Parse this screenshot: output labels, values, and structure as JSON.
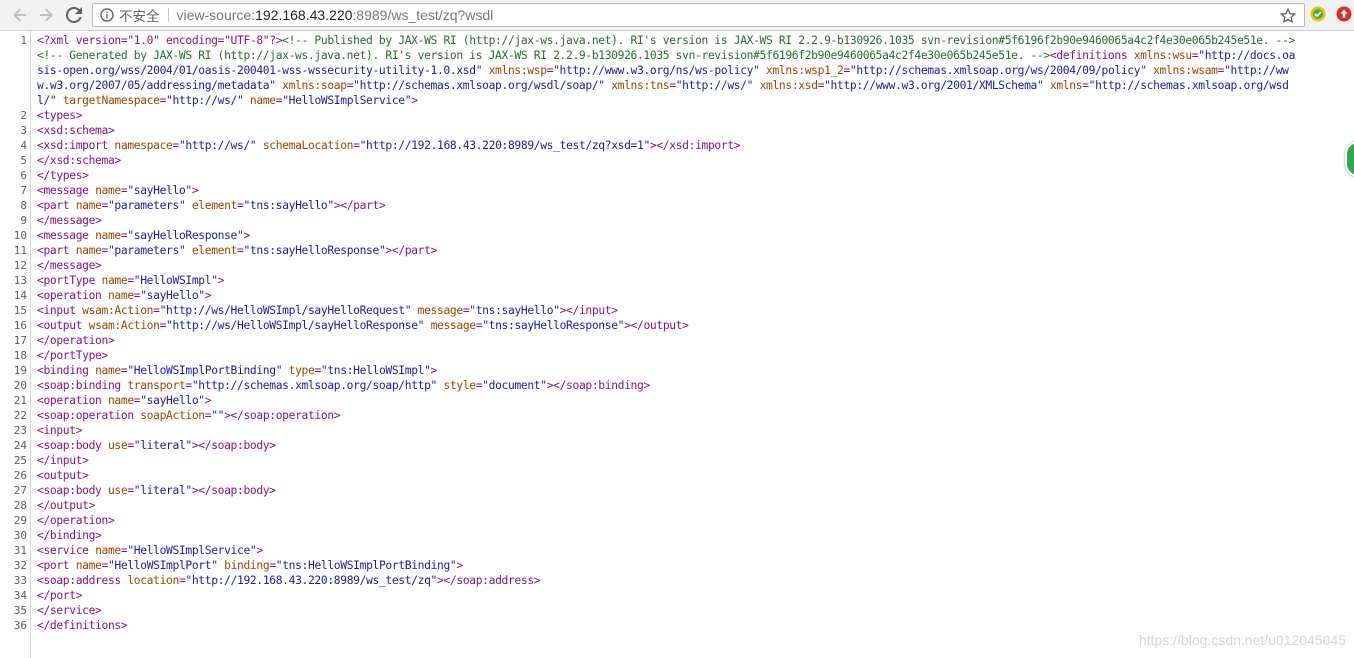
{
  "browser": {
    "security_label": "不安全",
    "url_scheme": "view-source:",
    "url_host": "192.168.43.220",
    "url_rest": ":8989/ws_test/zq?wsdl"
  },
  "source_lines": [
    {
      "n": "1",
      "parts": [
        [
          "pi",
          "<?xml version=\"1.0\" encoding=\"UTF-8\"?>"
        ],
        [
          "cm",
          "<!-- Published by JAX-WS RI (http://jax-ws.java.net). RI's version is JAX-WS RI 2.2.9-b130926.1035 svn-revision#5f6196f2b90e9460065a4c2f4e30e065b245e51e. -->"
        ],
        [
          "cm",
          "<!-- Generated by JAX-WS RI (http://jax-ws.java.net). RI's version is JAX-WS RI 2.2.9-b130926.1035 svn-revision#5f6196f2b90e9460065a4c2f4e30e065b245e51e. -->"
        ],
        [
          "t",
          "<definitions "
        ],
        [
          "an",
          "xmlns:wsu"
        ],
        [
          "t",
          "="
        ],
        [
          "av",
          "\"http://docs.oasis-open.org/wss/2004/01/oasis-200401-wss-wssecurity-utility-1.0.xsd\""
        ],
        [
          "t",
          " "
        ],
        [
          "an",
          "xmlns:wsp"
        ],
        [
          "t",
          "="
        ],
        [
          "av",
          "\"http://www.w3.org/ns/ws-policy\""
        ],
        [
          "t",
          " "
        ],
        [
          "an",
          "xmlns:wsp1_2"
        ],
        [
          "t",
          "="
        ],
        [
          "av",
          "\"http://schemas.xmlsoap.org/ws/2004/09/policy\""
        ],
        [
          "t",
          " "
        ],
        [
          "an",
          "xmlns:wsam"
        ],
        [
          "t",
          "="
        ],
        [
          "av",
          "\"http://www.w3.org/2007/05/addressing/metadata\""
        ],
        [
          "t",
          " "
        ],
        [
          "an",
          "xmlns:soap"
        ],
        [
          "t",
          "="
        ],
        [
          "av",
          "\"http://schemas.xmlsoap.org/wsdl/soap/\""
        ],
        [
          "t",
          " "
        ],
        [
          "an",
          "xmlns:tns"
        ],
        [
          "t",
          "="
        ],
        [
          "av",
          "\"http://ws/\""
        ],
        [
          "t",
          " "
        ],
        [
          "an",
          "xmlns:xsd"
        ],
        [
          "t",
          "="
        ],
        [
          "av",
          "\"http://www.w3.org/2001/XMLSchema\""
        ],
        [
          "t",
          " "
        ],
        [
          "an",
          "xmlns"
        ],
        [
          "t",
          "="
        ],
        [
          "av",
          "\"http://schemas.xmlsoap.org/wsdl/\""
        ],
        [
          "t",
          " "
        ],
        [
          "an",
          "targetNamespace"
        ],
        [
          "t",
          "="
        ],
        [
          "av",
          "\"http://ws/\""
        ],
        [
          "t",
          " "
        ],
        [
          "an",
          "name"
        ],
        [
          "t",
          "="
        ],
        [
          "av",
          "\"HelloWSImplService\""
        ],
        [
          "t",
          ">"
        ]
      ]
    },
    {
      "n": "2",
      "parts": [
        [
          "t",
          "<types>"
        ]
      ]
    },
    {
      "n": "3",
      "parts": [
        [
          "t",
          "<xsd:schema>"
        ]
      ]
    },
    {
      "n": "4",
      "parts": [
        [
          "t",
          "<xsd:import "
        ],
        [
          "an",
          "namespace"
        ],
        [
          "t",
          "="
        ],
        [
          "av",
          "\"http://ws/\""
        ],
        [
          "t",
          " "
        ],
        [
          "an",
          "schemaLocation"
        ],
        [
          "t",
          "="
        ],
        [
          "av",
          "\"http://192.168.43.220:8989/ws_test/zq?xsd=1\""
        ],
        [
          "t",
          "></xsd:import>"
        ]
      ]
    },
    {
      "n": "5",
      "parts": [
        [
          "t",
          "</xsd:schema>"
        ]
      ]
    },
    {
      "n": "6",
      "parts": [
        [
          "t",
          "</types>"
        ]
      ]
    },
    {
      "n": "7",
      "parts": [
        [
          "t",
          "<message "
        ],
        [
          "an",
          "name"
        ],
        [
          "t",
          "="
        ],
        [
          "av",
          "\"sayHello\""
        ],
        [
          "t",
          ">"
        ]
      ]
    },
    {
      "n": "8",
      "parts": [
        [
          "t",
          "<part "
        ],
        [
          "an",
          "name"
        ],
        [
          "t",
          "="
        ],
        [
          "av",
          "\"parameters\""
        ],
        [
          "t",
          " "
        ],
        [
          "an",
          "element"
        ],
        [
          "t",
          "="
        ],
        [
          "av",
          "\"tns:sayHello\""
        ],
        [
          "t",
          "></part>"
        ]
      ]
    },
    {
      "n": "9",
      "parts": [
        [
          "t",
          "</message>"
        ]
      ]
    },
    {
      "n": "10",
      "parts": [
        [
          "t",
          "<message "
        ],
        [
          "an",
          "name"
        ],
        [
          "t",
          "="
        ],
        [
          "av",
          "\"sayHelloResponse\""
        ],
        [
          "t",
          ">"
        ]
      ]
    },
    {
      "n": "11",
      "parts": [
        [
          "t",
          "<part "
        ],
        [
          "an",
          "name"
        ],
        [
          "t",
          "="
        ],
        [
          "av",
          "\"parameters\""
        ],
        [
          "t",
          " "
        ],
        [
          "an",
          "element"
        ],
        [
          "t",
          "="
        ],
        [
          "av",
          "\"tns:sayHelloResponse\""
        ],
        [
          "t",
          "></part>"
        ]
      ]
    },
    {
      "n": "12",
      "parts": [
        [
          "t",
          "</message>"
        ]
      ]
    },
    {
      "n": "13",
      "parts": [
        [
          "t",
          "<portType "
        ],
        [
          "an",
          "name"
        ],
        [
          "t",
          "="
        ],
        [
          "av",
          "\"HelloWSImpl\""
        ],
        [
          "t",
          ">"
        ]
      ]
    },
    {
      "n": "14",
      "parts": [
        [
          "t",
          "<operation "
        ],
        [
          "an",
          "name"
        ],
        [
          "t",
          "="
        ],
        [
          "av",
          "\"sayHello\""
        ],
        [
          "t",
          ">"
        ]
      ]
    },
    {
      "n": "15",
      "parts": [
        [
          "t",
          "<input "
        ],
        [
          "an",
          "wsam:Action"
        ],
        [
          "t",
          "="
        ],
        [
          "av",
          "\"http://ws/HelloWSImpl/sayHelloRequest\""
        ],
        [
          "t",
          " "
        ],
        [
          "an",
          "message"
        ],
        [
          "t",
          "="
        ],
        [
          "av",
          "\"tns:sayHello\""
        ],
        [
          "t",
          "></input>"
        ]
      ]
    },
    {
      "n": "16",
      "parts": [
        [
          "t",
          "<output "
        ],
        [
          "an",
          "wsam:Action"
        ],
        [
          "t",
          "="
        ],
        [
          "av",
          "\"http://ws/HelloWSImpl/sayHelloResponse\""
        ],
        [
          "t",
          " "
        ],
        [
          "an",
          "message"
        ],
        [
          "t",
          "="
        ],
        [
          "av",
          "\"tns:sayHelloResponse\""
        ],
        [
          "t",
          "></output>"
        ]
      ]
    },
    {
      "n": "17",
      "parts": [
        [
          "t",
          "</operation>"
        ]
      ]
    },
    {
      "n": "18",
      "parts": [
        [
          "t",
          "</portType>"
        ]
      ]
    },
    {
      "n": "19",
      "parts": [
        [
          "t",
          "<binding "
        ],
        [
          "an",
          "name"
        ],
        [
          "t",
          "="
        ],
        [
          "av",
          "\"HelloWSImplPortBinding\""
        ],
        [
          "t",
          " "
        ],
        [
          "an",
          "type"
        ],
        [
          "t",
          "="
        ],
        [
          "av",
          "\"tns:HelloWSImpl\""
        ],
        [
          "t",
          ">"
        ]
      ]
    },
    {
      "n": "20",
      "parts": [
        [
          "t",
          "<soap:binding "
        ],
        [
          "an",
          "transport"
        ],
        [
          "t",
          "="
        ],
        [
          "av",
          "\"http://schemas.xmlsoap.org/soap/http\""
        ],
        [
          "t",
          " "
        ],
        [
          "an",
          "style"
        ],
        [
          "t",
          "="
        ],
        [
          "av",
          "\"document\""
        ],
        [
          "t",
          "></soap:binding>"
        ]
      ]
    },
    {
      "n": "21",
      "parts": [
        [
          "t",
          "<operation "
        ],
        [
          "an",
          "name"
        ],
        [
          "t",
          "="
        ],
        [
          "av",
          "\"sayHello\""
        ],
        [
          "t",
          ">"
        ]
      ]
    },
    {
      "n": "22",
      "parts": [
        [
          "t",
          "<soap:operation "
        ],
        [
          "an",
          "soapAction"
        ],
        [
          "t",
          "="
        ],
        [
          "av",
          "\"\""
        ],
        [
          "t",
          "></soap:operation>"
        ]
      ]
    },
    {
      "n": "23",
      "parts": [
        [
          "t",
          "<input>"
        ]
      ]
    },
    {
      "n": "24",
      "parts": [
        [
          "t",
          "<soap:body "
        ],
        [
          "an",
          "use"
        ],
        [
          "t",
          "="
        ],
        [
          "av",
          "\"literal\""
        ],
        [
          "t",
          "></soap:body>"
        ]
      ]
    },
    {
      "n": "25",
      "parts": [
        [
          "t",
          "</input>"
        ]
      ]
    },
    {
      "n": "26",
      "parts": [
        [
          "t",
          "<output>"
        ]
      ]
    },
    {
      "n": "27",
      "parts": [
        [
          "t",
          "<soap:body "
        ],
        [
          "an",
          "use"
        ],
        [
          "t",
          "="
        ],
        [
          "av",
          "\"literal\""
        ],
        [
          "t",
          "></soap:body>"
        ]
      ]
    },
    {
      "n": "28",
      "parts": [
        [
          "t",
          "</output>"
        ]
      ]
    },
    {
      "n": "29",
      "parts": [
        [
          "t",
          "</operation>"
        ]
      ]
    },
    {
      "n": "30",
      "parts": [
        [
          "t",
          "</binding>"
        ]
      ]
    },
    {
      "n": "31",
      "parts": [
        [
          "t",
          "<service "
        ],
        [
          "an",
          "name"
        ],
        [
          "t",
          "="
        ],
        [
          "av",
          "\"HelloWSImplService\""
        ],
        [
          "t",
          ">"
        ]
      ]
    },
    {
      "n": "32",
      "parts": [
        [
          "t",
          "<port "
        ],
        [
          "an",
          "name"
        ],
        [
          "t",
          "="
        ],
        [
          "av",
          "\"HelloWSImplPort\""
        ],
        [
          "t",
          " "
        ],
        [
          "an",
          "binding"
        ],
        [
          "t",
          "="
        ],
        [
          "av",
          "\"tns:HelloWSImplPortBinding\""
        ],
        [
          "t",
          ">"
        ]
      ]
    },
    {
      "n": "33",
      "parts": [
        [
          "t",
          "<soap:address "
        ],
        [
          "an",
          "location"
        ],
        [
          "t",
          "="
        ],
        [
          "av",
          "\"http://192.168.43.220:8989/ws_test/zq\""
        ],
        [
          "t",
          "></soap:address>"
        ]
      ]
    },
    {
      "n": "34",
      "parts": [
        [
          "t",
          "</port>"
        ]
      ]
    },
    {
      "n": "35",
      "parts": [
        [
          "t",
          "</service>"
        ]
      ]
    },
    {
      "n": "36",
      "parts": [
        [
          "t",
          "</definitions>"
        ]
      ]
    }
  ],
  "watermark": "https://blog.csdn.net/u012045045",
  "icons": {
    "back": "arrow-left-icon",
    "forward": "arrow-right-icon",
    "reload": "reload-icon",
    "info": "info-icon",
    "star": "star-icon",
    "extension_1": "extension-icon",
    "extension_2": "extension-icon"
  },
  "colors": {
    "tag": "#881280",
    "attr_name": "#994500",
    "attr_value": "#1a1aa6",
    "comment": "#236e25"
  }
}
